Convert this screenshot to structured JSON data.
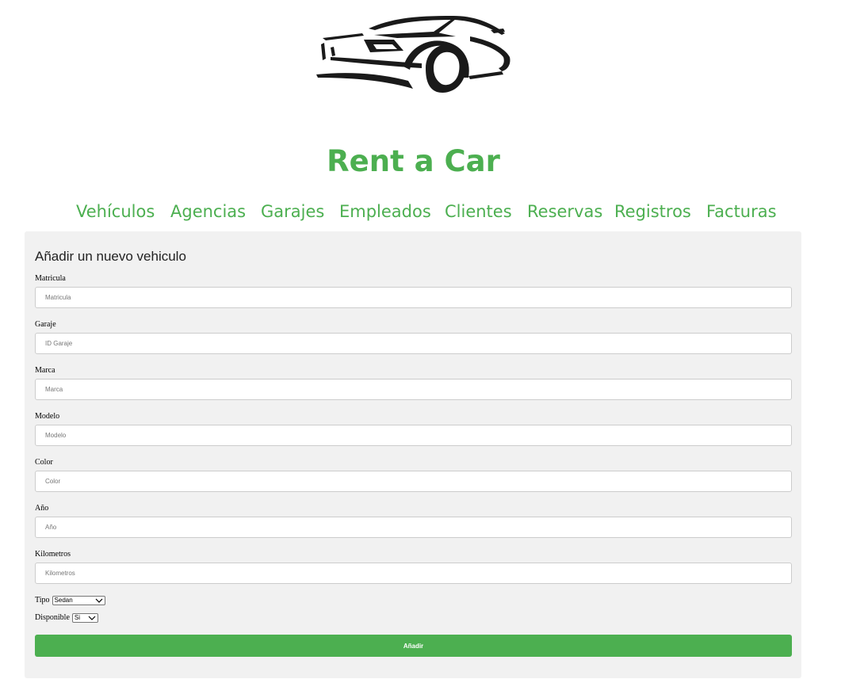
{
  "header": {
    "logo_icon": "sports-car-silhouette-icon",
    "title": "Rent a Car"
  },
  "nav": {
    "items": [
      {
        "label": "Vehículos"
      },
      {
        "label": "Agencias"
      },
      {
        "label": "Garajes"
      },
      {
        "label": "Empleados"
      },
      {
        "label": "Clientes"
      },
      {
        "label": "Reservas"
      },
      {
        "label": "Registros"
      },
      {
        "label": "Facturas"
      }
    ]
  },
  "form": {
    "title": "Añadir un nuevo vehiculo",
    "fields": [
      {
        "label": "Matricula",
        "placeholder": "Matricula",
        "value": ""
      },
      {
        "label": "Garaje",
        "placeholder": "ID Garaje",
        "value": ""
      },
      {
        "label": "Marca",
        "placeholder": "Marca",
        "value": ""
      },
      {
        "label": "Modelo",
        "placeholder": "Modelo",
        "value": ""
      },
      {
        "label": "Color",
        "placeholder": "Color",
        "value": ""
      },
      {
        "label": "Año",
        "placeholder": "Año",
        "value": ""
      },
      {
        "label": "Kilometros",
        "placeholder": "Kilometros",
        "value": ""
      }
    ],
    "tipo": {
      "label": "Tipo",
      "selected": "Sedan"
    },
    "disponible": {
      "label": "Disponible",
      "selected": "Si"
    },
    "submit_label": "Añadir"
  },
  "colors": {
    "accent": "#4caf50",
    "panel_bg": "#f1f1f1"
  }
}
